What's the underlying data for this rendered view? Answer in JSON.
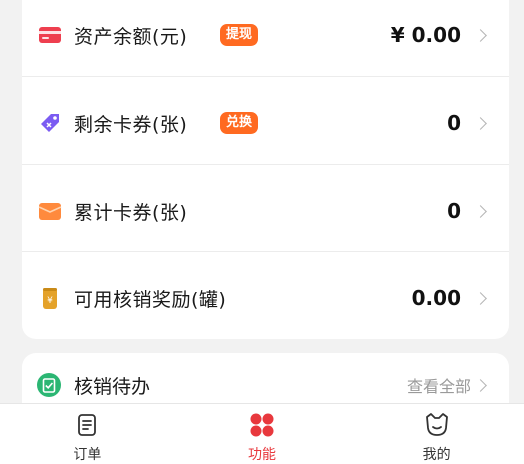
{
  "rows": [
    {
      "label": "资产余额(元)",
      "badge": "提现",
      "value": "¥ 0.00"
    },
    {
      "label": "剩余卡券(张)",
      "badge": "兑换",
      "value": "0"
    },
    {
      "label": "累计卡券(张)",
      "badge": "",
      "value": "0"
    },
    {
      "label": "可用核销奖励(罐)",
      "badge": "",
      "value": "0.00"
    }
  ],
  "todo": {
    "title": "核销待办",
    "more": "查看全部"
  },
  "tabs": [
    {
      "label": "订单",
      "icon": "clipboard-icon"
    },
    {
      "label": "功能",
      "icon": "grid-dots-icon"
    },
    {
      "label": "我的",
      "icon": "cat-face-icon"
    }
  ],
  "colors": {
    "accent": "#e8383d",
    "badge": "#ff6a21"
  }
}
